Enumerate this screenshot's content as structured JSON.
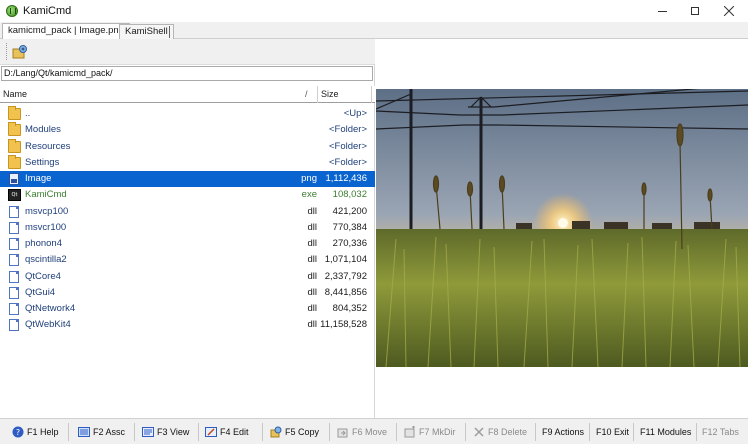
{
  "window": {
    "title": "KamiCmd"
  },
  "tabs": [
    {
      "label": "kamicmd_pack | Image.png",
      "active": true
    },
    {
      "label": "KamiShell",
      "active": false
    }
  ],
  "left_panel": {
    "path": "D:/Lang/Qt/kamicmd_pack/",
    "columns": {
      "name": "Name",
      "sort_indicator": "/",
      "size": "Size"
    },
    "rows": [
      {
        "name": "..",
        "ext": "",
        "size": "<Up>",
        "icon": "folder-up-icon"
      },
      {
        "name": "Modules",
        "ext": "",
        "size": "<Folder>",
        "icon": "folder-icon"
      },
      {
        "name": "Resources",
        "ext": "",
        "size": "<Folder>",
        "icon": "folder-icon"
      },
      {
        "name": "Settings",
        "ext": "",
        "size": "<Folder>",
        "icon": "folder-icon"
      },
      {
        "name": "Image",
        "ext": "png",
        "size": "1,112,436",
        "icon": "image-file-icon",
        "selected": true
      },
      {
        "name": "KamiCmd",
        "ext": "exe",
        "size": "108,032",
        "icon": "exe-icon"
      },
      {
        "name": "msvcp100",
        "ext": "dll",
        "size": "421,200",
        "icon": "file-icon"
      },
      {
        "name": "msvcr100",
        "ext": "dll",
        "size": "770,384",
        "icon": "file-icon"
      },
      {
        "name": "phonon4",
        "ext": "dll",
        "size": "270,336",
        "icon": "file-icon"
      },
      {
        "name": "qscintilla2",
        "ext": "dll",
        "size": "1,071,104",
        "icon": "file-icon"
      },
      {
        "name": "QtCore4",
        "ext": "dll",
        "size": "2,337,792",
        "icon": "file-icon"
      },
      {
        "name": "QtGui4",
        "ext": "dll",
        "size": "8,441,856",
        "icon": "file-icon"
      },
      {
        "name": "QtNetwork4",
        "ext": "dll",
        "size": "804,352",
        "icon": "file-icon"
      },
      {
        "name": "QtWebKit4",
        "ext": "dll",
        "size": "11,158,528",
        "icon": "file-icon"
      }
    ]
  },
  "exe_icon_text": "Qt",
  "function_keys": [
    {
      "label": "F1 Help",
      "icon": "help-icon",
      "enabled": true
    },
    {
      "label": "F2 Assc",
      "icon": "assoc-icon",
      "enabled": true
    },
    {
      "label": "F3 View",
      "icon": "view-icon",
      "enabled": true
    },
    {
      "label": "F4 Edit",
      "icon": "edit-icon",
      "enabled": true
    },
    {
      "label": "F5 Copy",
      "icon": "copy-icon",
      "enabled": true
    },
    {
      "label": "F6 Move",
      "icon": "move-icon",
      "enabled": false
    },
    {
      "label": "F7 MkDir",
      "icon": "mkdir-icon",
      "enabled": false
    },
    {
      "label": "F8 Delete",
      "icon": "delete-icon",
      "enabled": false
    },
    {
      "label": "F9 Actions",
      "icon": "",
      "enabled": true
    },
    {
      "label": "F10 Exit",
      "icon": "",
      "enabled": true
    },
    {
      "label": "F11 Modules",
      "icon": "",
      "enabled": true
    },
    {
      "label": "F12 Tabs",
      "icon": "",
      "enabled": false
    }
  ],
  "colors": {
    "selection": "#0a64d0",
    "folder_text": "#1f3f7a",
    "exe_text": "#3c7d32"
  }
}
